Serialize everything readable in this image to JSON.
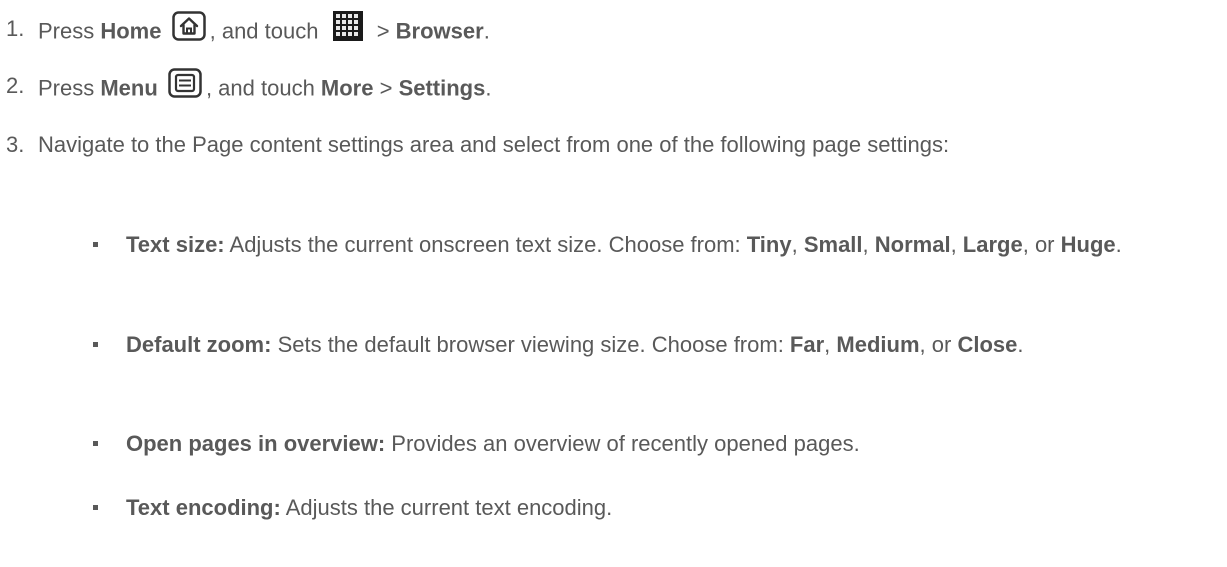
{
  "steps": [
    {
      "number": "1.",
      "parts": {
        "press": "Press ",
        "home": "Home",
        "touch": ", and touch ",
        "sep": " > ",
        "browser": "Browser",
        "end": "."
      },
      "icons": [
        "home-icon",
        "apps-grid-icon"
      ]
    },
    {
      "number": "2.",
      "parts": {
        "press": "Press ",
        "menu": "Menu",
        "touch": ", and touch ",
        "more": "More",
        "sep": " > ",
        "settings": "Settings",
        "end": "."
      },
      "icons": [
        "menu-icon"
      ]
    },
    {
      "number": "3.",
      "text": "Navigate to the Page content settings area and select from one of the following page settings:"
    }
  ],
  "bullets": [
    {
      "term": "Text size:",
      "desc": " Adjusts the current onscreen text size. Choose from: ",
      "options": [
        "Tiny",
        "Small",
        "Normal",
        "Large",
        "Huge"
      ],
      "joiners": [
        ", ",
        ", ",
        ", ",
        ", or "
      ],
      "end": "."
    },
    {
      "term": "Default zoom:",
      "desc": " Sets the default browser viewing size. Choose from: ",
      "options": [
        "Far",
        "Medium",
        "Close"
      ],
      "joiners": [
        ", ",
        ", or "
      ],
      "end": "."
    },
    {
      "term": "Open pages in overview:",
      "desc": " Provides an overview of recently opened pages."
    },
    {
      "term": "Text encoding:",
      "desc": " Adjusts the current text encoding."
    }
  ]
}
